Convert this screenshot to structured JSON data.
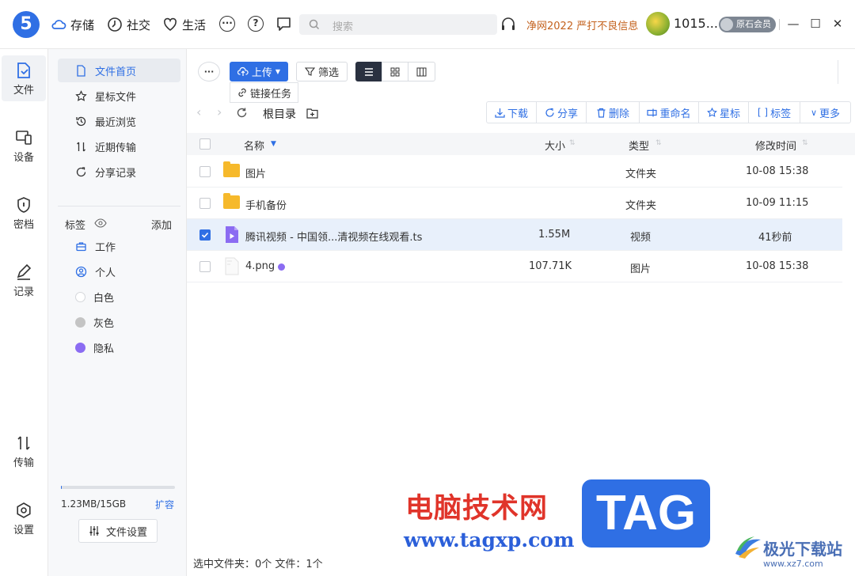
{
  "app": {
    "logo_glyph": "5",
    "accent": "#2f6fe4"
  },
  "topnav": [
    {
      "label": "存储",
      "icon": "cloud-icon"
    },
    {
      "label": "社交",
      "icon": "clock-icon"
    },
    {
      "label": "生活",
      "icon": "heart-icon"
    }
  ],
  "search": {
    "placeholder": "搜索"
  },
  "promo": "净网2022 严打不良信息",
  "user": {
    "name": "1015...",
    "badge": "原石会员"
  },
  "rail": [
    {
      "label": "文件",
      "icon": "file-icon",
      "active": true
    },
    {
      "label": "设备",
      "icon": "device-icon"
    },
    {
      "label": "密档",
      "icon": "shield-icon"
    },
    {
      "label": "记录",
      "icon": "pen-icon"
    },
    {
      "label": "传输",
      "icon": "transfer-icon"
    },
    {
      "label": "设置",
      "icon": "gear-icon"
    }
  ],
  "sidebar": {
    "items": [
      {
        "label": "文件首页",
        "icon": "doc-icon",
        "active": true
      },
      {
        "label": "星标文件",
        "icon": "star-icon"
      },
      {
        "label": "最近浏览",
        "icon": "history-icon"
      },
      {
        "label": "近期传输",
        "icon": "transfer-icon"
      },
      {
        "label": "分享记录",
        "icon": "share-icon"
      }
    ],
    "tags_title": "标签",
    "tags_add": "添加",
    "tags": [
      {
        "label": "工作",
        "icon": "briefcase-icon"
      },
      {
        "label": "个人",
        "icon": "person-icon"
      },
      {
        "label": "白色",
        "color": "#ffffff"
      },
      {
        "label": "灰色",
        "color": "#c4c4c4"
      },
      {
        "label": "隐私",
        "color": "#8b6cf2"
      }
    ],
    "storage": {
      "used_text": "1.23MB/15GB",
      "expand": "扩容",
      "used_fraction": 0.0001
    },
    "settings_button": "文件设置"
  },
  "toolbar": {
    "upload": "上传",
    "link_task": "链接任务",
    "filter": "筛选"
  },
  "path": {
    "current": "根目录"
  },
  "actions": [
    "下载",
    "分享",
    "删除",
    "重命名",
    "星标",
    "标签",
    "更多"
  ],
  "table": {
    "columns": [
      "名称",
      "大小",
      "类型",
      "修改时间"
    ],
    "rows": [
      {
        "name": "图片",
        "size": "",
        "type": "文件夹",
        "modified": "10-08 15:38",
        "kind": "folder",
        "selected": false
      },
      {
        "name": "手机备份",
        "size": "",
        "type": "文件夹",
        "modified": "10-09 11:15",
        "kind": "folder",
        "selected": false
      },
      {
        "name": "腾讯视频 - 中国领...清视频在线观看.ts",
        "size": "1.55M",
        "type": "视频",
        "modified": "41秒前",
        "kind": "video",
        "selected": true
      },
      {
        "name": "4.png",
        "size": "107.71K",
        "type": "图片",
        "modified": "10-08 15:38",
        "kind": "image",
        "selected": false,
        "tag_color": "#8b6cf2"
      }
    ]
  },
  "status": "选中文件夹：0个 文件：1个",
  "watermark": {
    "cn": "电脑技术网",
    "url": "www.tagxp.com",
    "tag": "TAG",
    "site_cn": "极光下载站",
    "site_url": "www.xz7.com"
  }
}
